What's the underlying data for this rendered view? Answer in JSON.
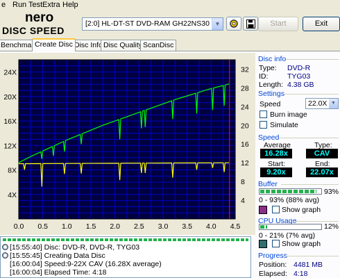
{
  "menu": {
    "items": [
      {
        "label": "e"
      },
      {
        "label": "Run Test"
      },
      {
        "label": "Extra"
      },
      {
        "label": "Help"
      }
    ]
  },
  "logo": {
    "line1": "nero",
    "line2": "DISC SPEED"
  },
  "toolbar": {
    "drive_value": "[2:0]  HL-DT-ST DVD-RAM GH22NS30 1.02",
    "start_label": "Start",
    "exit_label": "Exit",
    "settings_icon": "settings-wheel-icon",
    "save_icon": "floppy-disk-icon"
  },
  "tabs": [
    {
      "label": "Benchmark",
      "active": false
    },
    {
      "label": "Create Disc",
      "active": true
    },
    {
      "label": "Disc Info",
      "active": false
    },
    {
      "label": "Disc Quality",
      "active": false
    },
    {
      "label": "ScanDisc",
      "active": false
    }
  ],
  "chart_data": {
    "type": "line",
    "x_ticks": [
      "0.0",
      "0.5",
      "1.0",
      "1.5",
      "2.0",
      "2.5",
      "3.0",
      "3.5",
      "4.0",
      "4.5"
    ],
    "y_left_ticks": [
      "4X",
      "8X",
      "12X",
      "16X",
      "20X",
      "24X"
    ],
    "y_right_ticks": [
      "4",
      "8",
      "12",
      "16",
      "20",
      "24",
      "28",
      "32"
    ],
    "xlim": [
      0,
      4.5
    ],
    "y_left_lim": [
      0,
      26
    ],
    "y_right_lim": [
      0,
      34
    ],
    "end_marker_x": 4.38,
    "colors": {
      "background": "#000040",
      "grid": "#0000c8",
      "speed": "#00ff00",
      "rpm": "#ffff00",
      "marker": "#ff0000"
    },
    "series": [
      {
        "axis": "left",
        "color": "#00ff00",
        "x": [
          0.0,
          0.25,
          0.5,
          0.75,
          1.0,
          1.25,
          1.5,
          1.75,
          2.0,
          2.25,
          2.5,
          2.75,
          3.0,
          3.25,
          3.5,
          3.75,
          4.0,
          4.25,
          4.38
        ],
        "y": [
          9.2,
          10.2,
          11.1,
          12.0,
          12.9,
          13.7,
          14.5,
          15.3,
          16.0,
          16.7,
          17.4,
          18.1,
          18.8,
          19.5,
          20.1,
          20.7,
          21.3,
          21.8,
          22.07
        ],
        "dips": [
          {
            "x": 0.48,
            "y": 9.8
          },
          {
            "x": 0.72,
            "y": 10.3
          },
          {
            "x": 0.95,
            "y": 11.0
          },
          {
            "x": 1.3,
            "y": 12.2
          },
          {
            "x": 2.1,
            "y": 13.0
          },
          {
            "x": 2.55,
            "y": 14.8
          },
          {
            "x": 2.63,
            "y": 15.0
          },
          {
            "x": 3.2,
            "y": 16.3
          },
          {
            "x": 3.7,
            "y": 17.2
          },
          {
            "x": 4.03,
            "y": 17.8
          },
          {
            "x": 4.27,
            "y": 18.5
          }
        ]
      },
      {
        "axis": "right",
        "color": "#ffff00",
        "x": [
          0.0,
          4.38
        ],
        "y": [
          11.8,
          12.0
        ],
        "dips": [
          {
            "x": 0.12,
            "y": 10.5
          },
          {
            "x": 0.48,
            "y": 6.9
          },
          {
            "x": 0.95,
            "y": 9.6
          },
          {
            "x": 1.3,
            "y": 9.7
          },
          {
            "x": 2.1,
            "y": 8.3
          },
          {
            "x": 2.55,
            "y": 9.8
          },
          {
            "x": 2.63,
            "y": 9.8
          },
          {
            "x": 3.2,
            "y": 8.8
          },
          {
            "x": 3.7,
            "y": 10.5
          },
          {
            "x": 4.03,
            "y": 10.9
          },
          {
            "x": 4.27,
            "y": 10.0
          }
        ]
      }
    ]
  },
  "disc_info": {
    "title": "Disc info",
    "type_label": "Type:",
    "type_value": "DVD-R",
    "id_label": "ID:",
    "id_value": "TYG03",
    "length_label": "Length:",
    "length_value": "4.38 GB"
  },
  "settings": {
    "title": "Settings",
    "speed_label": "Speed",
    "speed_value": "22.0X",
    "burn_image_label": "Burn image",
    "simulate_label": "Simulate"
  },
  "speed": {
    "title": "Speed",
    "average_label": "Average",
    "average_value": "16.28x",
    "type_label": "Type:",
    "type_value": "CAV",
    "start_label": "Start:",
    "start_value": "9.20x",
    "end_label": "End:",
    "end_value": "22.07x"
  },
  "buffer": {
    "title": "Buffer",
    "percent_text": "93%",
    "fill_fraction": 0.93,
    "range_text": "0 - 93% (88% avg)",
    "show_graph_label": "Show graph",
    "color": "#8b2f8b"
  },
  "cpu": {
    "title": "CPU Usage",
    "percent_text": "12%",
    "fill_fraction": 0.12,
    "range_text": "0 - 21% (7% avg)",
    "show_graph_label": "Show graph",
    "color": "#2f6f6f"
  },
  "progress": {
    "title": "Progress",
    "position_label": "Position:",
    "position_value": "4481 MB",
    "elapsed_label": "Elapsed:",
    "elapsed_value": "4:18"
  },
  "log": {
    "rows": [
      {
        "time": "[15:55:40]",
        "text": "Disc: DVD-R, DVD-R, TYG03"
      },
      {
        "time": "[15:55:45]",
        "text": "Creating Data Disc"
      },
      {
        "time": "[16:00:04]",
        "text": "Speed:9-22X CAV (16.28X average)"
      },
      {
        "time": "[16:00:04]",
        "text": "Elapsed Time:  4:18"
      }
    ]
  }
}
